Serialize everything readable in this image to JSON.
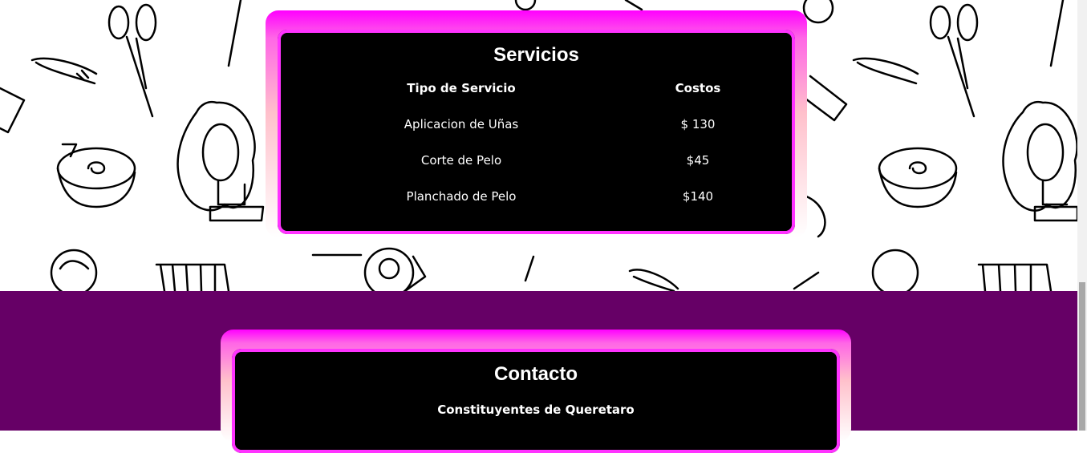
{
  "services": {
    "title": "Servicios",
    "columns": [
      "Tipo de Servicio",
      "Costos"
    ],
    "rows": [
      {
        "service": "Aplicacion de Uñas",
        "cost": "$ 130"
      },
      {
        "service": "Corte de Pelo",
        "cost": "$45"
      },
      {
        "service": "Planchado de Pelo",
        "cost": "$140"
      }
    ]
  },
  "contact": {
    "title": "Contacto",
    "address": "Constituyentes de Queretaro"
  },
  "colors": {
    "purple_band": "#660066",
    "frame_magenta": "#ff00ff",
    "frame_pink": "#ffc0cb",
    "panel": "#000000"
  },
  "background": {
    "pattern_icons": [
      "scissors-icon",
      "bobby-pin-icon",
      "comb-icon",
      "mannequin-head-icon",
      "hair-dye-bowl-icon",
      "brush-icon",
      "hair-dryer-icon"
    ]
  }
}
